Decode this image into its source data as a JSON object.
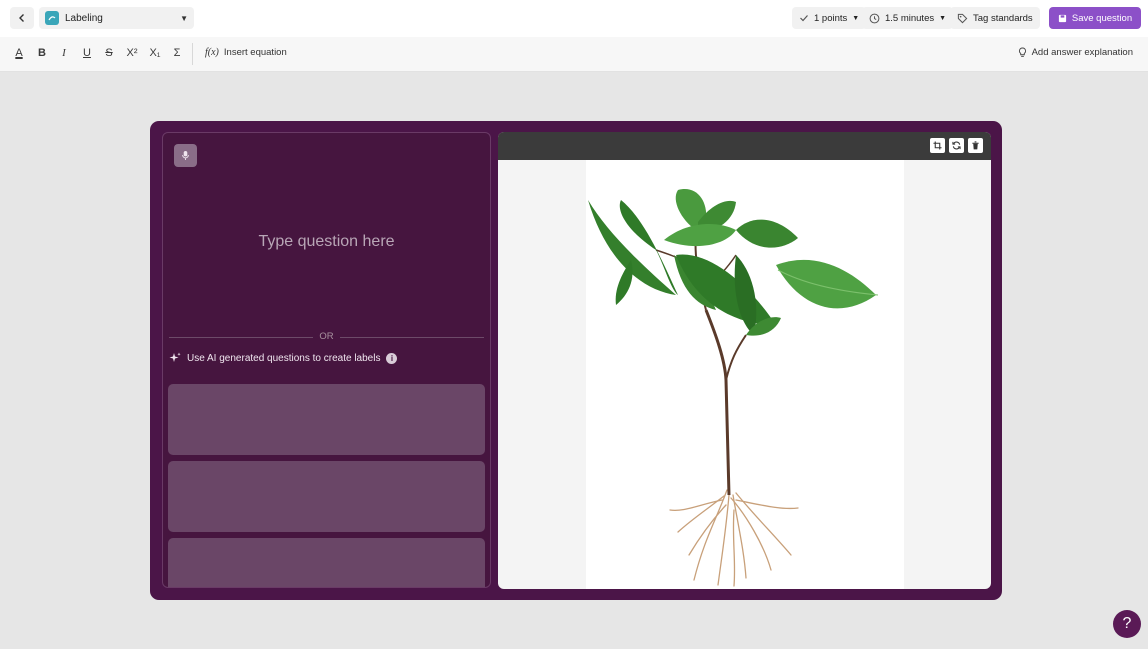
{
  "topbar": {
    "question_type": "Labeling",
    "points": "1 points",
    "time": "1.5 minutes",
    "tag_standards": "Tag standards",
    "save": "Save question"
  },
  "format_toolbar": {
    "text_color": "A",
    "bold": "B",
    "italic": "I",
    "underline": "U",
    "strikethrough": "S",
    "superscript": "X²",
    "subscript": "X₁",
    "sum": "Σ",
    "insert_equation_icon": "f(x)",
    "insert_equation": "Insert equation",
    "add_answer_explanation": "Add answer explanation"
  },
  "editor": {
    "question_placeholder": "Type question here",
    "or_divider": "OR",
    "ai_prompt": "Use AI generated questions to create labels",
    "info_icon": "i"
  },
  "help": {
    "label": "?"
  },
  "colors": {
    "accent": "#8c50c8",
    "card_bg": "#4b1548",
    "help_bg": "#5a1a56"
  },
  "icons": [
    "chevron-left-icon",
    "labeling-type-icon",
    "check-icon",
    "clock-icon",
    "tag-icon",
    "save-icon",
    "lightbulb-icon",
    "mic-icon",
    "sparkle-icon",
    "info-icon",
    "crop-icon",
    "replace-icon",
    "trash-icon",
    "help-icon"
  ]
}
